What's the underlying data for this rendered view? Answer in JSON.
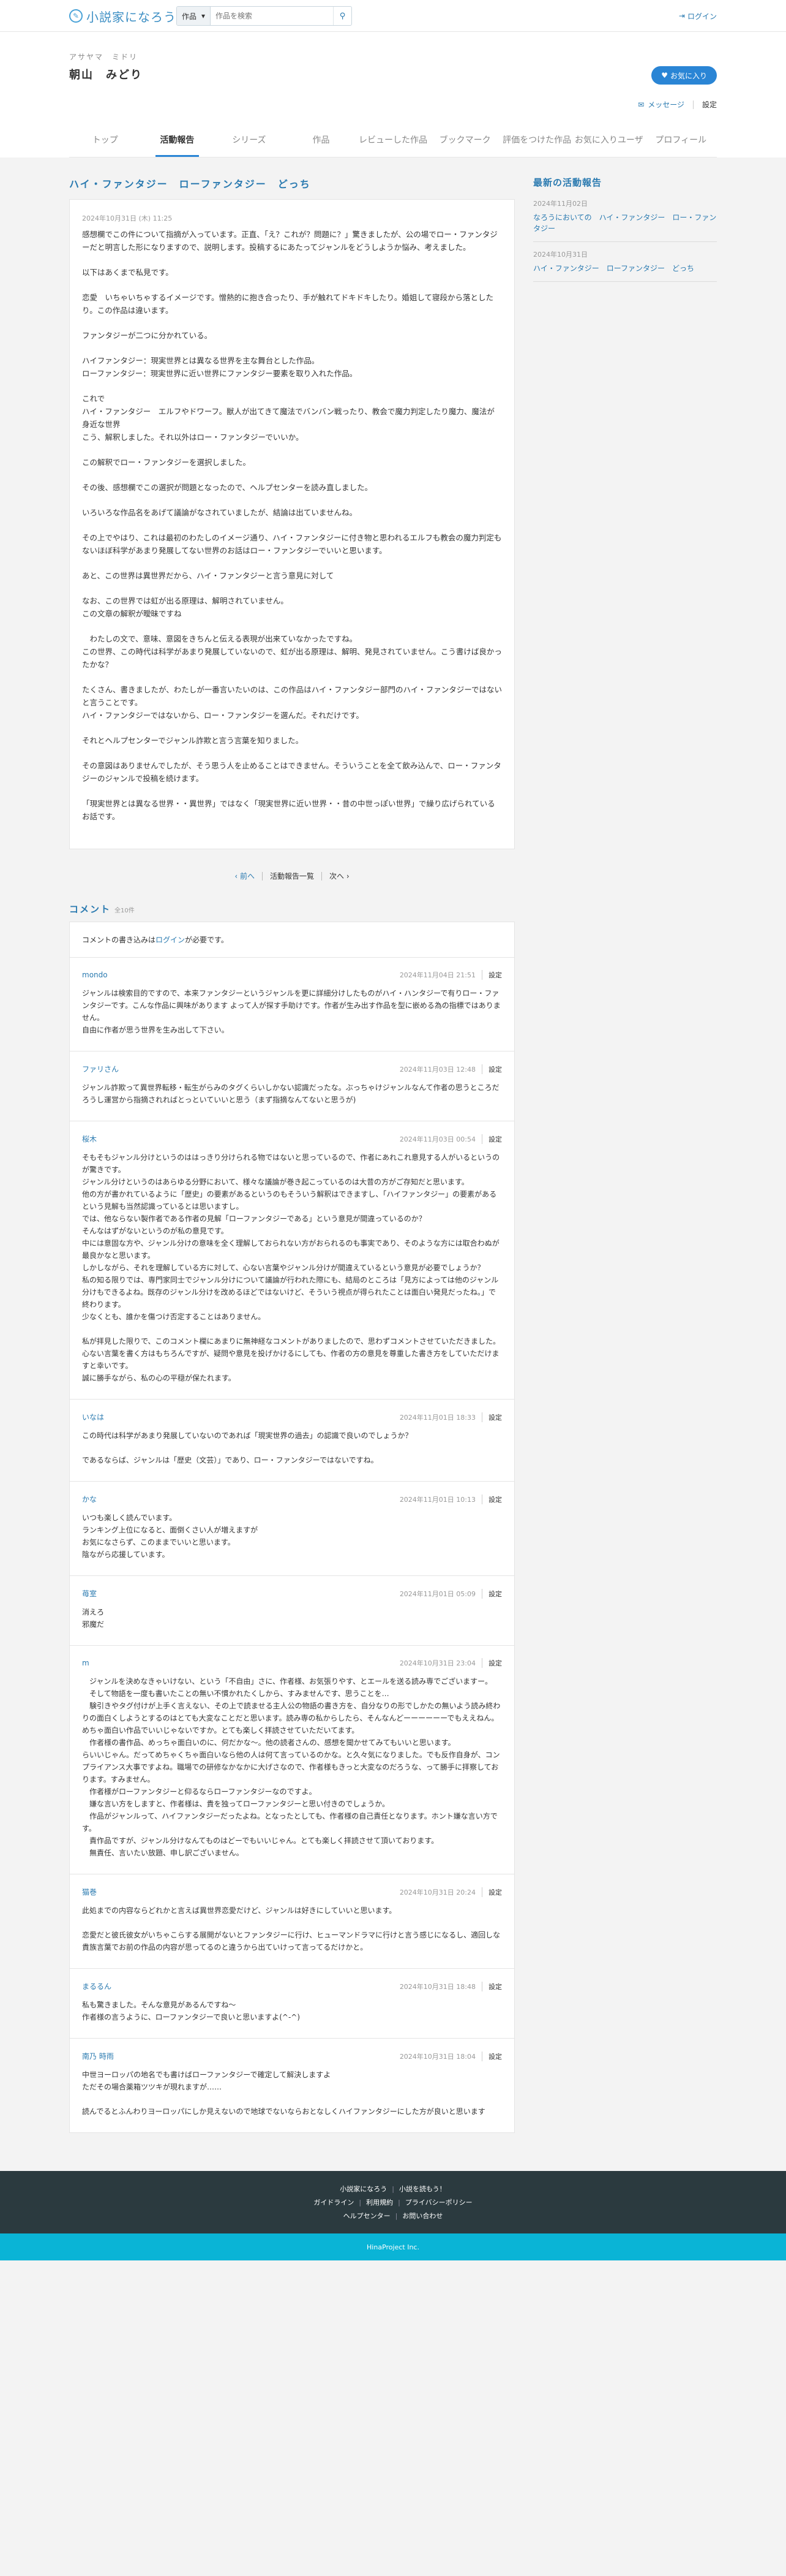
{
  "header": {
    "logo_text": "小説家になろう",
    "search_category": "作品",
    "search_placeholder": "作品を検索",
    "login_label": "ログイン"
  },
  "user": {
    "kana": "アサヤマ　ミドリ",
    "name": "朝山　みどり",
    "favorite_button": "お気に入り",
    "message_label": "メッセージ",
    "settings_label": "設定"
  },
  "tabs": [
    "トップ",
    "活動報告",
    "シリーズ",
    "作品",
    "レビューした作品",
    "ブックマーク",
    "評価をつけた作品",
    "お気に入りユーザ",
    "プロフィール"
  ],
  "report": {
    "title": "ハイ・ファンタジー　ローファンタジー　どっち",
    "date": "2024年10月31日 (木) 11:25",
    "paragraphs": [
      "感想欄でこの件について指摘が入っています。正直、「え？これが？問題に？」驚きましたが、公の場でロー・ファンタジーだと明言した形になりますので、説明します。投稿するにあたってジャンルをどうしようか悩み、考えました。",
      "以下はあくまで私見です。",
      "恋愛　いちゃいちゃするイメージです。憎熱的に抱き合ったり、手が触れてドキドキしたり。婚姐して寝段から落としたり。この作品は違います。",
      "ファンタジーが二つに分かれている。",
      "ハイファンタジー：現実世界とは異なる世界を主な舞台とした作品。\nローファンタジー：現実世界に近い世界にファンタジー要素を取り入れた作品。",
      "これで\nハイ・ファンタジー　エルフやドワーフ。獣人が出てきて魔法でバンバン戦ったり、教会で魔力判定したり魔力、魔法が身近な世界\nこう、解釈しました。それ以外はロー・ファンタジーでいいか。",
      "この解釈でロー・ファンタジーを選択しました。",
      "その後、感想欄でこの選択が問題となったので、ヘルプセンターを読み直しました。",
      "いろいろな作品名をあげて議論がなされていましたが、結論は出ていませんね。",
      "その上でやはり、これは最初のわたしのイメージ通り、ハイ・ファンタジーに付き物と思われるエルフも教会の魔力判定もないほぼ科学があまり発展してない世界のお話はロー・ファンタジーでいいと思います。",
      "あと、この世界は異世界だから、ハイ・ファンタジーと言う意見に対して",
      "なお、この世界では虹が出る原理は、解明されていません。\nこの文章の解釈が曖昧ですね",
      "　わたしの文で、意味、意図をきちんと伝える表現が出来ていなかったですね。\nこの世界、この時代は科学があまり発展していないので、虹が出る原理は、解明、発見されていません。こう書けば良かったかな？",
      "たくさん、書きましたが、わたしが一番言いたいのは、この作品はハイ・ファンタジー部門のハイ・ファンタジーではないと言うことです。\nハイ・ファンタジーではないから、ロー・ファンタジーを選んだ。それだけです。",
      "それとヘルプセンターでジャンル詐欺と言う言葉を知りました。",
      "その意図はありませんでしたが、そう思う人を止めることはできません。そういうことを全て飲み込んで、ロー・ファンタジーのジャンルで投稿を続けます。",
      "「現実世界とは異なる世界・・異世界」ではなく「現実世界に近い世界・・昔の中世っぽい世界」で繰り広げられているお話です。"
    ]
  },
  "pager": {
    "prev": "前へ",
    "list": "活動報告一覧",
    "next": "次へ"
  },
  "comments": {
    "title": "コメント",
    "count": "全10件",
    "notice_prefix": "コメントの書き込みは",
    "notice_link": "ログイン",
    "notice_suffix": "が必要です。",
    "settings_label": "設定",
    "items": [
      {
        "author": "mondo",
        "date": "2024年11月04日 21:51",
        "body": "ジャンルは検索目的ですので、本来ファンタジーというジャンルを更に詳細分けしたものがハイ・ハンタジーで有りロー・ファンタジーです。こんな作品に興味があります よって人が探す手助けです。作者が生み出す作品を型に嵌める為の指標ではありません。\n自由に作者が思う世界を生み出して下さい。"
      },
      {
        "author": "ファリさん",
        "date": "2024年11月03日 12:48",
        "body": "ジャンル詐欺って異世界転移・転生がらみのタグくらいしかない認識だったな。ぶっちゃけジャンルなんて作者の思うところだろうし運営から指摘されればとっといていいと思う（まず指摘なんてないと思うが)"
      },
      {
        "author": "桜木",
        "date": "2024年11月03日 00:54",
        "body": "そもそもジャンル分けというのははっきり分けられる物ではないと思っているので、作者にあれこれ意見する人がいるというのが驚きです。\nジャンル分けというのはあらゆる分野において、様々な議論が巻き起こっているのは大昔の方がご存知だと思います。\n他の方が書かれているように「歴史」の要素があるというのもそういう解釈はできますし、「ハイファンタジー」の要素があるという見解も当然認識っているとは思いますし。\nでは、他ならない製作者である作者の見解「ローファンタジーである」という意見が間違っているのか？\nそんなはずがないというのが私の意見です。\n中には意固な方や、ジャンル分けの意味を全く理解しておられない方がおられるのも事実であり、そのような方には取合わぬが最良かなと思います。\nしかしながら、それを理解している方に対して、心ない言葉やジャンル分けが間違えているという意見が必要でしょうか？\n私の知る限りでは、専門家同士でジャンル分けについて議論が行われた際にも、結局のところは「見方によっては他のジャンル分けもできるよね。既存のジャンル分けを改めるほどではないけど、そういう視点が得られたことは面白い発見だったね。」で終わります。\n少なくとも、誰かを傷つけ否定することはありません。\n\n私が拝見した限りで、このコメント欄にあまりに無神経なコメントがありましたので、思わずコメントさせていただきました。\n心ない言葉を書く方はもちろんですが、疑問や意見を投げかけるにしても、作者の方の意見を尊重した書き方をしていただけますと幸いです。\n誠に勝手ながら、私の心の平穏が保たれます。"
      },
      {
        "author": "いなは",
        "date": "2024年11月01日 18:33",
        "body": "この時代は科学があまり発展していないのであれば「現実世界の過去」の認識で良いのでしょうか？\n\nであるならば、ジャンルは「歴史（文芸）」であり、ロー・ファンタジーではないですね。"
      },
      {
        "author": "かな",
        "date": "2024年11月01日 10:13",
        "body": "いつも楽しく読んでいます。\nランキング上位になると、面倒くさい人が増えますが\nお気になさらず、このままでいいと思います。\n陰ながら応援しています。"
      },
      {
        "author": "苺室",
        "date": "2024年11月01日 05:09",
        "body": "消えろ\n邪魔だ"
      },
      {
        "author": "m",
        "date": "2024年10月31日 23:04",
        "body": "　ジャンルを決めなきゃいけない、という「不自由」さに、作者様、お気張りやす、とエールを送る読み専でございますー。\n　そして物語を一度も書いたことの無い不慣かれたくしから、すみませんです、思うことを…\n　験引きやタグ付けが上手く言えない、その上で読ませる主人公の物語の書き方を、自分なりの形でしかたの無いよう読み終わりの面白くしようとするのはとても大変なことだと思います。読み専の私からしたら、そんなんどーーーーーーでもええねん。めちゃ面白い作品でいいじゃないですか。とても楽しく拝読させていただいてます。\n　作者様の書作品、めっちゃ面白いのに、何だかな〜。他の読者さんの、感想を聞かせてみてもいいと思います。\nらいいじゃん。だってめちゃくちゃ面白いなら他の人は何て言っているのかな。と久々気になりました。でも反作自身が、コンプライアンス大事ですよね。職場での研修なかなかに大げさなので、作者様もきっと大変なのだろうな、って勝手に拝察しております。すみません。\n　作者様がローファンタジーと仰るならローファンタジーなのですよ。\n　嫌な言い方をしますと、作者様は、貴を独ってローファンタジーと思い付きのでしょうか。\n　作品がジャンルって、ハイファンタジーだったよね。となったとしても、作者様の自己責任となります。ホント嫌な言い方です。\n　責作品ですが、ジャンル分けなんてものはどーでもいいじゃん。とても楽しく拝読させて頂いております。\n　無責任、言いたい放題、申し訳ございません。"
      },
      {
        "author": "猫巻",
        "date": "2024年10月31日 20:24",
        "body": "此処までの内容ならどれかと言えば異世界恋愛だけど、ジャンルは好きにしていいと思います。\n\n恋愛だと彼氏彼女がいちゃこらする展開がないとファンタジーに行け、ヒューマンドラマに行けと言う感じになるし、適回しな貴族言葉でお前の作品の内容が思ってるのと違うから出ていけって言ってるだけかと。"
      },
      {
        "author": "まるるん",
        "date": "2024年10月31日 18:48",
        "body": "私も驚きました。そんな意見があるんですね〜\n作者様の言うように、ローファンタジーで良いと思いますよ(^-^)"
      },
      {
        "author": "南乃 時雨",
        "date": "2024年10月31日 18:04",
        "body": "中世ヨーロッパの地名でも書けばローファンタジーで確定して解決しますよ\nただその場合薬箱ツツキが現れますが……\n\n読んでるとふんわりヨーロッパにしか見えないので地球でないならおとなしくハイファンタジーにした方が良いと思います"
      }
    ]
  },
  "sidebar": {
    "title": "最新の活動報告",
    "items": [
      {
        "date": "2024年11月02日",
        "link": "なろうにおいての　ハイ・ファンタジー　ロー・ファンタジー"
      },
      {
        "date": "2024年10月31日",
        "link": "ハイ・ファンタジー　ローファンタジー　どっち"
      }
    ]
  },
  "footer": {
    "row1": [
      "小説家になろう",
      "小説を読もう！"
    ],
    "row2": [
      "ガイドライン",
      "利用規約",
      "プライバシーポリシー"
    ],
    "row3": [
      "ヘルプセンター",
      "お問い合わせ"
    ],
    "copyright": "HinaProject Inc."
  },
  "colors": {
    "accent": "#2a7ab0",
    "button": "#2a85d5",
    "footer_bg": "#2b3a3f",
    "copyright_bg": "#0ab4d6"
  }
}
